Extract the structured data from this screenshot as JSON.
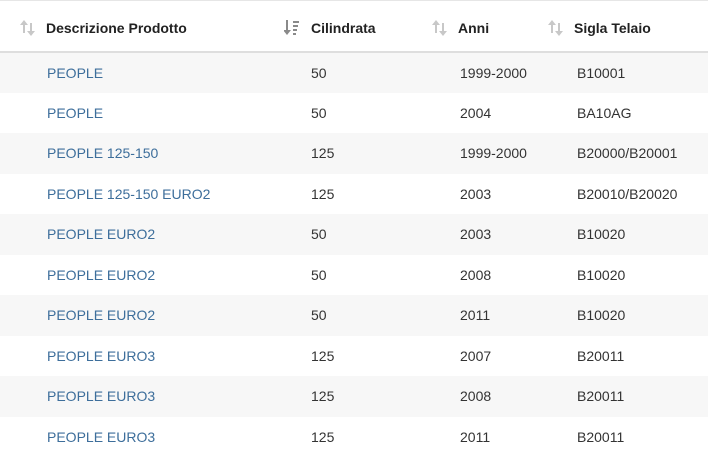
{
  "table": {
    "columns": [
      {
        "label": "Descrizione Prodotto",
        "sort_icon": "sort-neutral-icon"
      },
      {
        "label": "Cilindrata",
        "sort_icon": "sort-active-icon"
      },
      {
        "label": "Anni",
        "sort_icon": "sort-neutral-icon"
      },
      {
        "label": "Sigla Telaio",
        "sort_icon": "sort-neutral-icon"
      }
    ],
    "rows": [
      {
        "prodotto": "PEOPLE",
        "cilindrata": "50",
        "anni": "1999-2000",
        "sigla": "B10001"
      },
      {
        "prodotto": "PEOPLE",
        "cilindrata": "50",
        "anni": "2004",
        "sigla": "BA10AG"
      },
      {
        "prodotto": "PEOPLE 125-150",
        "cilindrata": "125",
        "anni": "1999-2000",
        "sigla": "B20000/B20001"
      },
      {
        "prodotto": "PEOPLE 125-150 EURO2",
        "cilindrata": "125",
        "anni": "2003",
        "sigla": "B20010/B20020"
      },
      {
        "prodotto": "PEOPLE EURO2",
        "cilindrata": "50",
        "anni": "2003",
        "sigla": "B10020"
      },
      {
        "prodotto": "PEOPLE EURO2",
        "cilindrata": "50",
        "anni": "2008",
        "sigla": "B10020"
      },
      {
        "prodotto": "PEOPLE EURO2",
        "cilindrata": "50",
        "anni": "2011",
        "sigla": "B10020"
      },
      {
        "prodotto": "PEOPLE EURO3",
        "cilindrata": "125",
        "anni": "2007",
        "sigla": "B20011"
      },
      {
        "prodotto": "PEOPLE EURO3",
        "cilindrata": "125",
        "anni": "2008",
        "sigla": "B20011"
      },
      {
        "prodotto": "PEOPLE EURO3",
        "cilindrata": "125",
        "anni": "2011",
        "sigla": "B20011"
      }
    ]
  },
  "colors": {
    "link": "#3d6e9b",
    "stripe": "#f7f7f7",
    "sort_icon_neutral": "#c8c8c8",
    "sort_icon_active": "#8a8a8a"
  }
}
